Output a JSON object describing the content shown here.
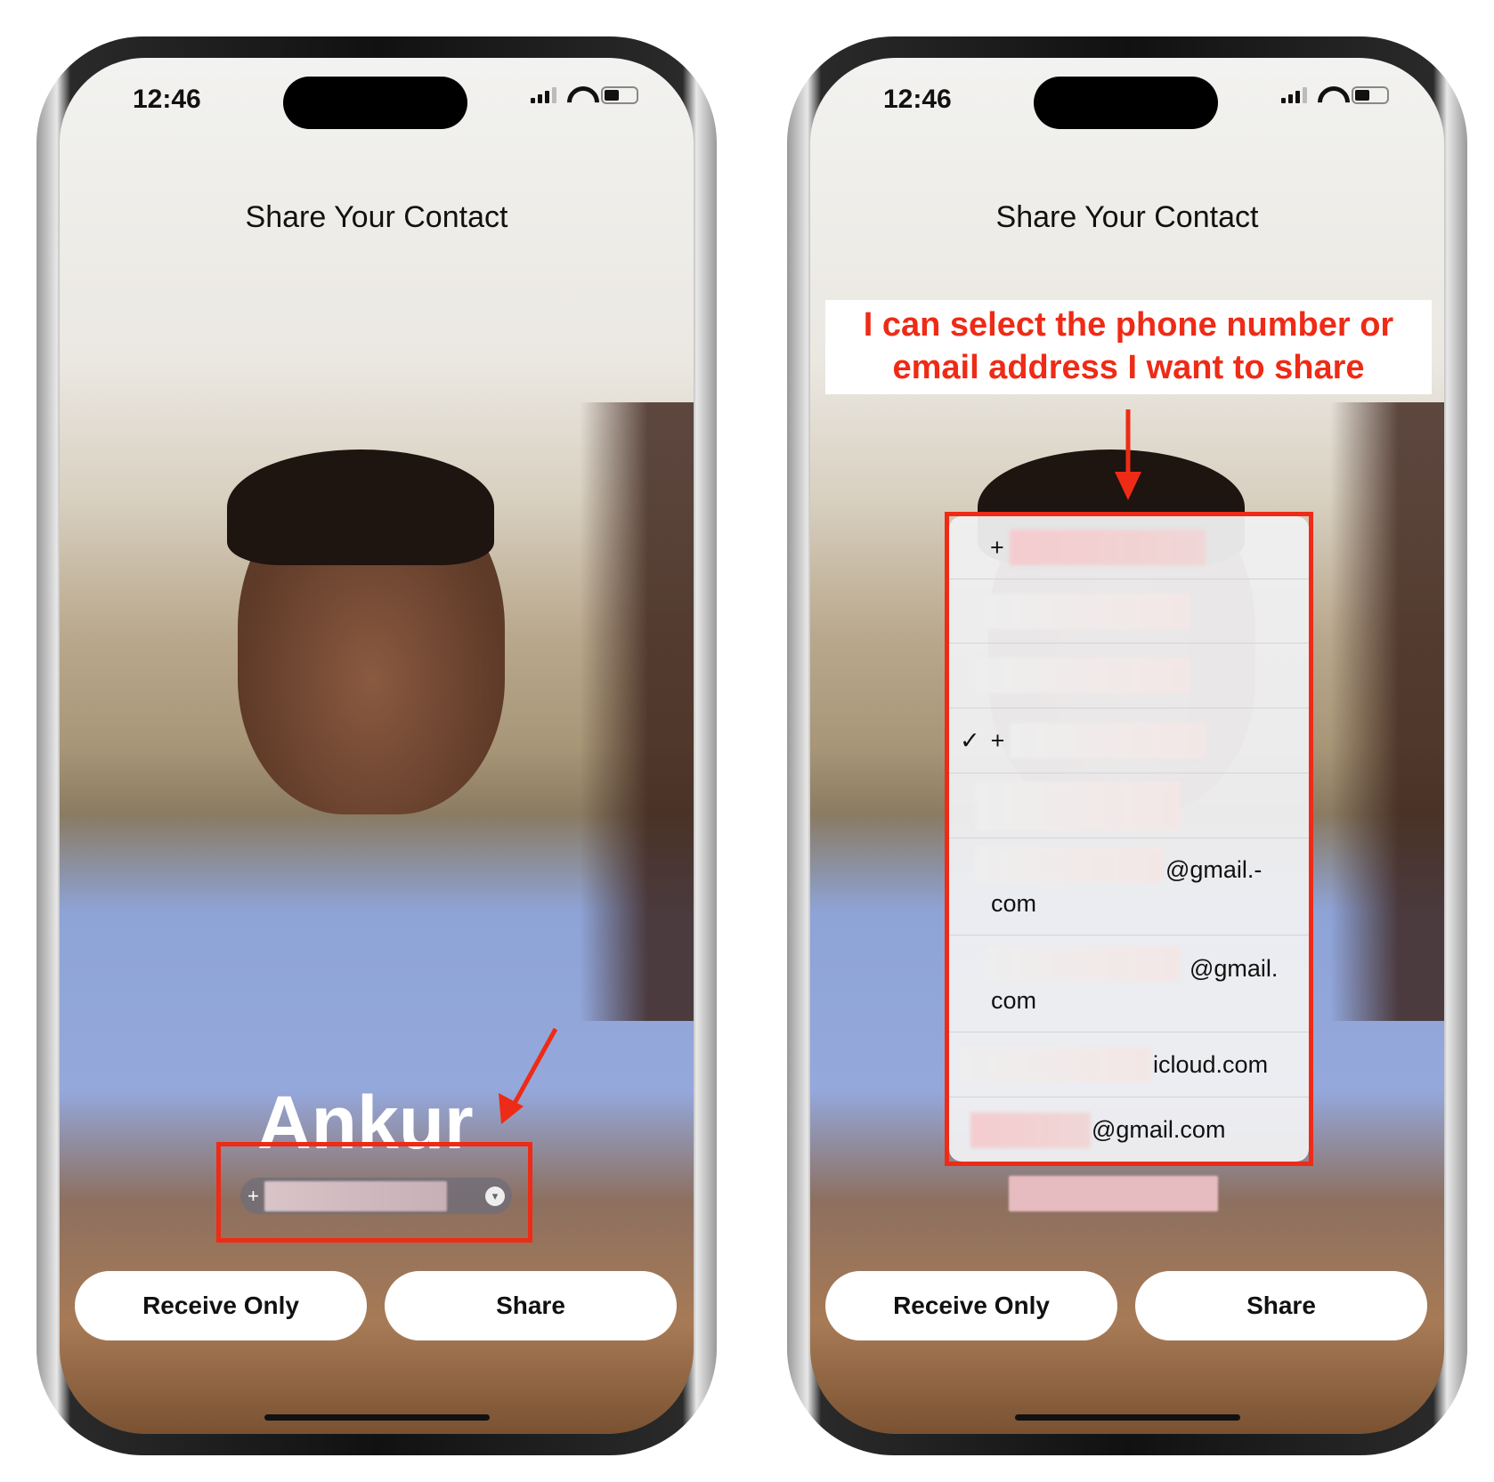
{
  "status": {
    "time": "12:46"
  },
  "screen_title": "Share Your Contact",
  "left": {
    "contact_name": "Ankur",
    "pill_prefix": "+",
    "buttons": {
      "receive": "Receive Only",
      "share": "Share"
    }
  },
  "right": {
    "annotation": "I can select the phone number or email address I want to share",
    "options": [
      {
        "prefix": "+",
        "text": "",
        "checked": false
      },
      {
        "prefix": "",
        "text": "",
        "checked": false
      },
      {
        "prefix": "",
        "text": "",
        "checked": false
      },
      {
        "prefix": "+",
        "text": "",
        "checked": true
      },
      {
        "prefix": "",
        "text": "",
        "checked": false
      },
      {
        "prefix": "",
        "text": "@gmail.-",
        "text2": "com",
        "checked": false
      },
      {
        "prefix": "",
        "text": "@gmail.",
        "text2": "com",
        "checked": false
      },
      {
        "prefix": "",
        "text": "icloud.com",
        "checked": false
      },
      {
        "prefix": "",
        "text": "@gmail.com",
        "checked": false
      }
    ],
    "checkmark": "✓",
    "buttons": {
      "receive": "Receive Only",
      "share": "Share"
    }
  },
  "annotation_color": "#ee2b16"
}
